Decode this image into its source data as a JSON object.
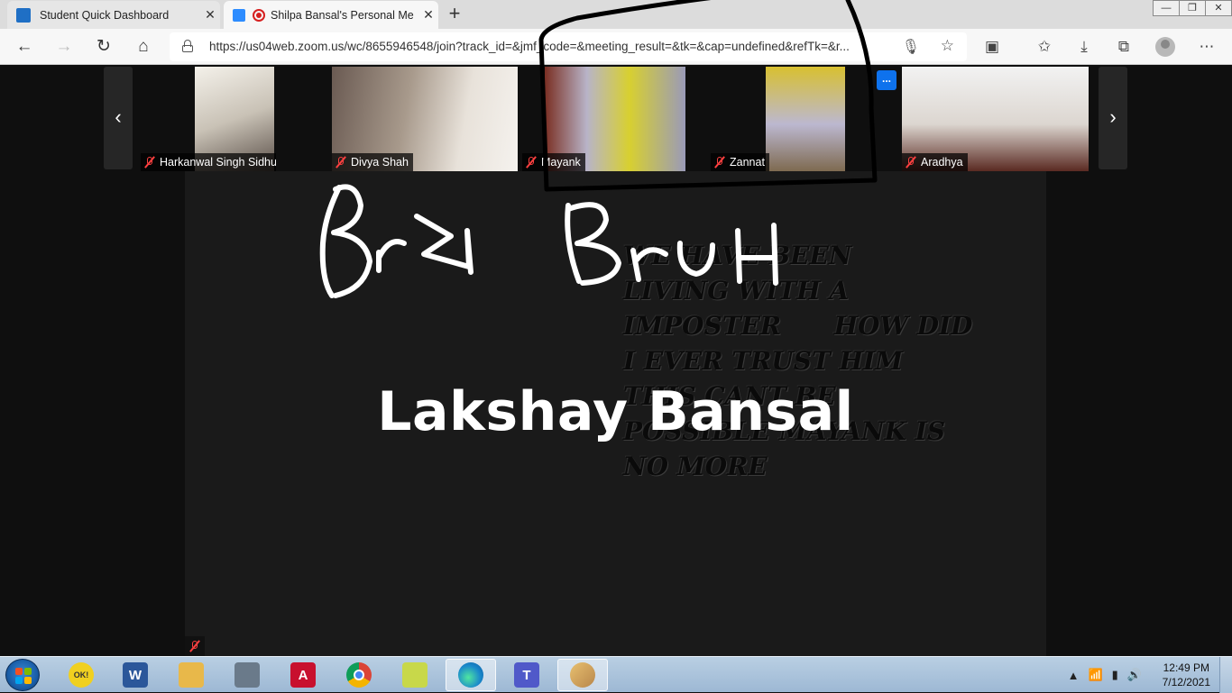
{
  "browser": {
    "tabs": [
      {
        "title": "Student Quick Dashboard",
        "active": false
      },
      {
        "title": "Shilpa Bansal's Personal Me",
        "active": true
      }
    ],
    "url": "https://us04web.zoom.us/wc/8655946548/join?track_id=&jmf_code=&meeting_result=&tk=&cap=undefined&refTk=&r...",
    "window_controls": [
      "—",
      "❐",
      "✕"
    ]
  },
  "meeting": {
    "participants": [
      {
        "name": "Harkanwal Singh Sidhu",
        "muted": true
      },
      {
        "name": "Divya Shah",
        "muted": true
      },
      {
        "name": "Mayank",
        "muted": true
      },
      {
        "name": "Zannat",
        "muted": true
      },
      {
        "name": "Aradhya",
        "muted": true
      }
    ],
    "more_label": "...",
    "active_speaker": "Lakshay Bansal",
    "annotation_text": [
      "We have been",
      "living with a",
      "imposter      how did",
      "i ever trust him",
      "this cant be",
      "possible mayank is",
      "no more"
    ],
    "nav_prev": "‹",
    "nav_next": "›"
  },
  "taskbar": {
    "apps": [
      {
        "name": "word-icon",
        "label": "W",
        "color": "#2b579a"
      },
      {
        "name": "file-explorer-icon",
        "label": "",
        "color": "#e8b84a"
      },
      {
        "name": "server-manager-icon",
        "label": "",
        "color": "#6a7a8a"
      },
      {
        "name": "acrobat-icon",
        "label": "A",
        "color": "#c8102e"
      },
      {
        "name": "chrome-icon",
        "label": "",
        "color": "#4285f4"
      },
      {
        "name": "sticky-notes-icon",
        "label": "",
        "color": "#c8d84a"
      },
      {
        "name": "edge-icon",
        "label": "",
        "color": "#1a8acb"
      },
      {
        "name": "teams-icon",
        "label": "T",
        "color": "#5059c9"
      },
      {
        "name": "paint-icon",
        "label": "",
        "color": "#d8a040"
      }
    ],
    "clock_time": "12:49 PM",
    "clock_date": "7/12/2021"
  }
}
